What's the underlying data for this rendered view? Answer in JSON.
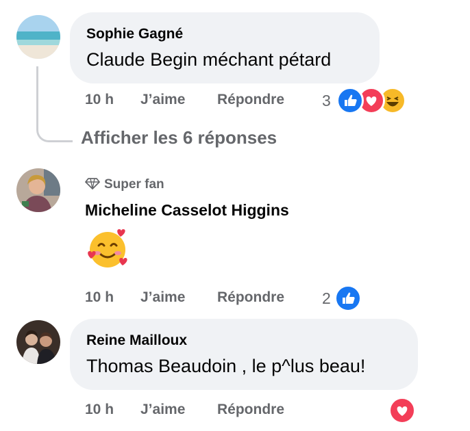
{
  "comments": [
    {
      "author": "Sophie Gagné",
      "text": "Claude Begin méchant pétard",
      "time": "10 h",
      "like_label": "J’aime",
      "reply_label": "Répondre",
      "reaction_count": "3",
      "reactions": [
        "like-icon",
        "love-icon",
        "haha-icon"
      ],
      "view_replies": "Afficher les 6 réponses"
    },
    {
      "badge": "Super fan",
      "author": "Micheline Casselot Higgins",
      "text": "🥰",
      "time": "10 h",
      "like_label": "J’aime",
      "reply_label": "Répondre",
      "reaction_count": "2",
      "reactions": [
        "like-icon"
      ]
    },
    {
      "author": "Reine Mailloux",
      "text": "Thomas Beaudoin , le p^lus beau!",
      "time": "10 h",
      "like_label": "J’aime",
      "reply_label": "Répondre",
      "reactions": [
        "love-icon"
      ]
    }
  ],
  "colors": {
    "like": "#1877f2",
    "love": "#f33e58",
    "haha": "#f7b928",
    "bubble": "#f0f2f5",
    "meta": "#65676b"
  }
}
